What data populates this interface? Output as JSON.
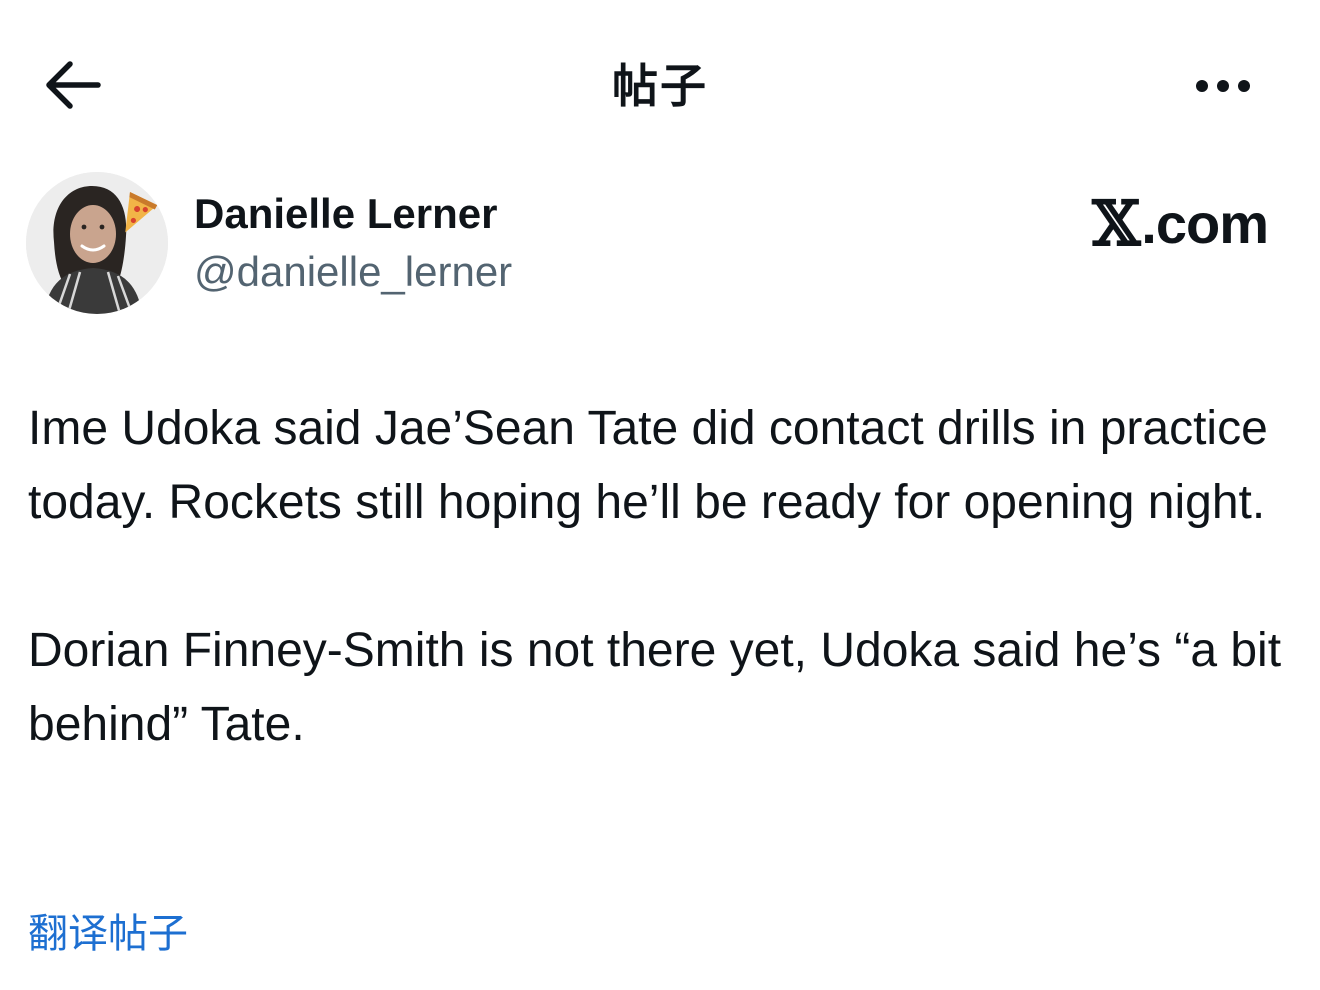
{
  "header": {
    "title": "帖子",
    "back_icon": "arrow-left-icon",
    "more_icon": "more-horizontal-icon"
  },
  "author": {
    "display_name": "Danielle Lerner",
    "handle": "@danielle_lerner",
    "avatar_emoji": "🍕"
  },
  "brand": {
    "mark": "𝕏",
    "label": ".com"
  },
  "post": {
    "paragraphs": [
      "Ime Udoka said Jae’Sean Tate did contact drills in practice today. Rockets still hoping he’ll be ready for opening night.",
      "Dorian Finney-Smith is not there yet, Udoka said he’s “a bit behind” Tate."
    ]
  },
  "translate": {
    "label": "翻译帖子"
  },
  "colors": {
    "text_primary": "#0f1419",
    "text_secondary": "#536471",
    "link": "#1d6fd1",
    "background": "#ffffff"
  }
}
